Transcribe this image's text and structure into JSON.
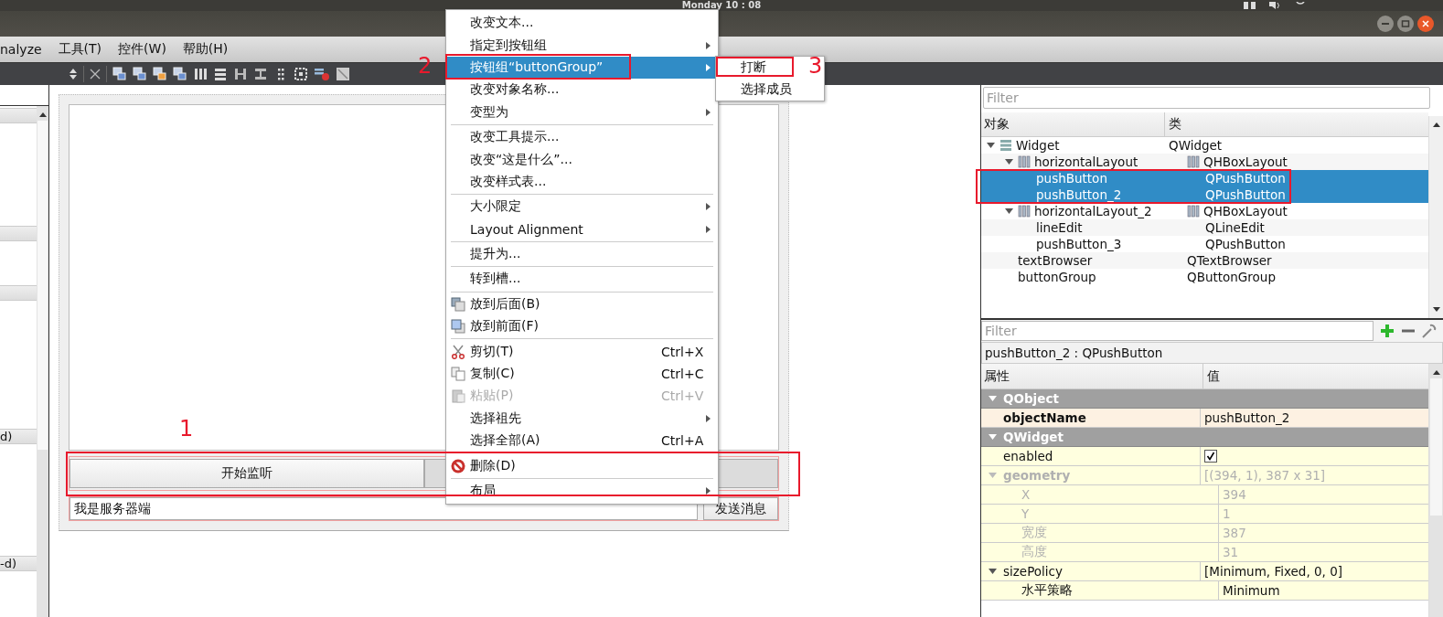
{
  "top_bar": {
    "clock": "Monday 10 : 08"
  },
  "menubar": [
    "nalyze",
    "工具(T)",
    "控件(W)",
    "帮助(H)"
  ],
  "widget_box": {
    "sections": [
      "d)",
      "-d)"
    ]
  },
  "form": {
    "buttons": [
      {
        "label": "开始监听",
        "current": false
      },
      {
        "current": true
      }
    ],
    "line_edit": {
      "value": "我是服务器端"
    },
    "send_button": "发送消息"
  },
  "context_menu": {
    "items": [
      {
        "kind": "item",
        "label": "改变文本...",
        "selected": false
      },
      {
        "kind": "item",
        "label": "指定到按钮组",
        "submenu": true,
        "selected": false
      },
      {
        "kind": "item",
        "label": "按钮组“buttonGroup”",
        "submenu": true,
        "selected": true
      },
      {
        "kind": "item",
        "label": "改变对象名称...",
        "selected": false
      },
      {
        "kind": "item",
        "label": "变型为",
        "submenu": true,
        "selected": false
      },
      {
        "kind": "separator"
      },
      {
        "kind": "item",
        "label": "改变工具提示...",
        "selected": false
      },
      {
        "kind": "item",
        "label": "改变“这是什么”...",
        "selected": false
      },
      {
        "kind": "item",
        "label": "改变样式表...",
        "selected": false
      },
      {
        "kind": "separator"
      },
      {
        "kind": "item",
        "label": "大小限定",
        "submenu": true,
        "selected": false
      },
      {
        "kind": "item",
        "label": "Layout Alignment",
        "submenu": true,
        "selected": false
      },
      {
        "kind": "separator"
      },
      {
        "kind": "item",
        "label": "提升为...",
        "selected": false
      },
      {
        "kind": "separator"
      },
      {
        "kind": "item",
        "label": "转到槽...",
        "selected": false
      },
      {
        "kind": "separator"
      },
      {
        "kind": "item",
        "label": "放到后面(B)",
        "selected": false
      },
      {
        "kind": "item",
        "label": "放到前面(F)",
        "selected": false
      },
      {
        "kind": "separator"
      },
      {
        "kind": "item",
        "label": "剪切(T)",
        "shortcut": "Ctrl+X",
        "selected": false
      },
      {
        "kind": "item",
        "label": "复制(C)",
        "shortcut": "Ctrl+C",
        "selected": false
      },
      {
        "kind": "item",
        "label": "粘贴(P)",
        "shortcut": "Ctrl+V",
        "disabled": true,
        "selected": false
      },
      {
        "kind": "item",
        "label": "选择祖先",
        "submenu": true,
        "selected": false
      },
      {
        "kind": "item",
        "label": "选择全部(A)",
        "shortcut": "Ctrl+A",
        "selected": false
      },
      {
        "kind": "separator"
      },
      {
        "kind": "item",
        "label": "删除(D)",
        "selected": false
      },
      {
        "kind": "separator"
      },
      {
        "kind": "item",
        "label": "布局",
        "submenu": true,
        "selected": false
      }
    ]
  },
  "submenu": {
    "items": [
      {
        "label": "打断"
      },
      {
        "label": "选择成员"
      }
    ]
  },
  "annotations": [
    "1",
    "2",
    "3"
  ],
  "object_inspector": {
    "filter_placeholder": "Filter",
    "columns": [
      "对象",
      "类"
    ],
    "rows": [
      {
        "name": "Widget",
        "class": "QWidget",
        "kind": "form",
        "expanded": true,
        "selected": false,
        "children": [
          {
            "name": "horizontalLayout",
            "class": "QHBoxLayout",
            "kind": "layout",
            "expanded": true,
            "selected": false,
            "children": [
              {
                "name": "pushButton",
                "class": "QPushButton",
                "selected": true
              },
              {
                "name": "pushButton_2",
                "class": "QPushButton",
                "selected": true
              }
            ]
          },
          {
            "name": "horizontalLayout_2",
            "class": "QHBoxLayout",
            "kind": "layout",
            "expanded": true,
            "selected": false,
            "children": [
              {
                "name": "lineEdit",
                "class": "QLineEdit",
                "selected": false
              },
              {
                "name": "pushButton_3",
                "class": "QPushButton",
                "selected": false
              }
            ]
          },
          {
            "name": "textBrowser",
            "class": "QTextBrowser",
            "selected": false
          },
          {
            "name": "buttonGroup",
            "class": "QButtonGroup",
            "selected": false
          }
        ]
      }
    ]
  },
  "property_editor": {
    "filter_placeholder": "Filter",
    "title": "pushButton_2 : QPushButton",
    "columns": [
      "属性",
      "值"
    ],
    "groups": [
      {
        "name": "QObject",
        "expanded": true,
        "properties": [
          {
            "name": "objectName",
            "value": "pushButton_2",
            "modified": true,
            "disabled": false
          }
        ]
      },
      {
        "name": "QWidget",
        "expanded": true,
        "properties": [
          {
            "kind": "check",
            "name": "enabled",
            "checked": true,
            "modified": false,
            "disabled": false
          },
          {
            "name": "geometry",
            "value": "[(394, 1), 387 x 31]",
            "modified": false,
            "disabled": true,
            "expanded": true,
            "children": [
              {
                "name": "X",
                "value": "394",
                "modified": false,
                "disabled": true
              },
              {
                "name": "Y",
                "value": "1",
                "modified": false,
                "disabled": true
              },
              {
                "name": "宽度",
                "value": "387",
                "modified": false,
                "disabled": true
              },
              {
                "name": "高度",
                "value": "31",
                "modified": false,
                "disabled": true
              }
            ]
          },
          {
            "name": "sizePolicy",
            "value": "[Minimum, Fixed, 0, 0]",
            "modified": false,
            "disabled": false,
            "expanded": true,
            "children": [
              {
                "name": "水平策略",
                "value": "Minimum",
                "modified": false,
                "disabled": false
              }
            ]
          }
        ]
      }
    ]
  }
}
